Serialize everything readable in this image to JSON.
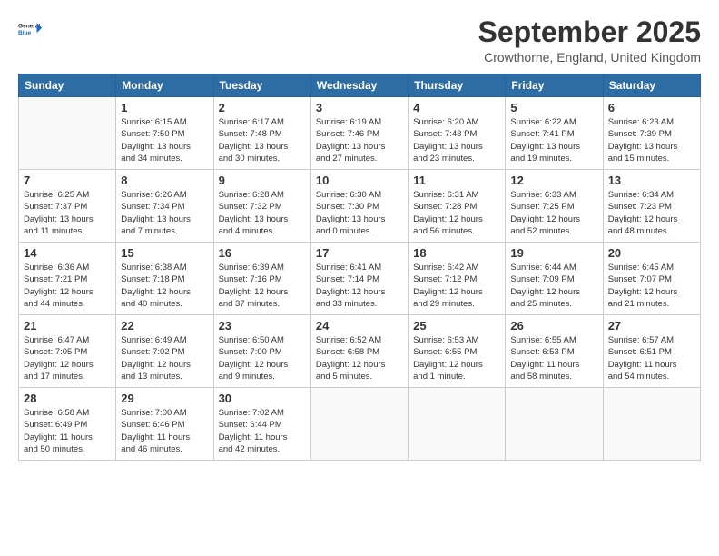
{
  "logo": {
    "general": "General",
    "blue": "Blue"
  },
  "header": {
    "month": "September 2025",
    "location": "Crowthorne, England, United Kingdom"
  },
  "days_of_week": [
    "Sunday",
    "Monday",
    "Tuesday",
    "Wednesday",
    "Thursday",
    "Friday",
    "Saturday"
  ],
  "weeks": [
    [
      {
        "day": "",
        "info": ""
      },
      {
        "day": "1",
        "info": "Sunrise: 6:15 AM\nSunset: 7:50 PM\nDaylight: 13 hours\nand 34 minutes."
      },
      {
        "day": "2",
        "info": "Sunrise: 6:17 AM\nSunset: 7:48 PM\nDaylight: 13 hours\nand 30 minutes."
      },
      {
        "day": "3",
        "info": "Sunrise: 6:19 AM\nSunset: 7:46 PM\nDaylight: 13 hours\nand 27 minutes."
      },
      {
        "day": "4",
        "info": "Sunrise: 6:20 AM\nSunset: 7:43 PM\nDaylight: 13 hours\nand 23 minutes."
      },
      {
        "day": "5",
        "info": "Sunrise: 6:22 AM\nSunset: 7:41 PM\nDaylight: 13 hours\nand 19 minutes."
      },
      {
        "day": "6",
        "info": "Sunrise: 6:23 AM\nSunset: 7:39 PM\nDaylight: 13 hours\nand 15 minutes."
      }
    ],
    [
      {
        "day": "7",
        "info": "Sunrise: 6:25 AM\nSunset: 7:37 PM\nDaylight: 13 hours\nand 11 minutes."
      },
      {
        "day": "8",
        "info": "Sunrise: 6:26 AM\nSunset: 7:34 PM\nDaylight: 13 hours\nand 7 minutes."
      },
      {
        "day": "9",
        "info": "Sunrise: 6:28 AM\nSunset: 7:32 PM\nDaylight: 13 hours\nand 4 minutes."
      },
      {
        "day": "10",
        "info": "Sunrise: 6:30 AM\nSunset: 7:30 PM\nDaylight: 13 hours\nand 0 minutes."
      },
      {
        "day": "11",
        "info": "Sunrise: 6:31 AM\nSunset: 7:28 PM\nDaylight: 12 hours\nand 56 minutes."
      },
      {
        "day": "12",
        "info": "Sunrise: 6:33 AM\nSunset: 7:25 PM\nDaylight: 12 hours\nand 52 minutes."
      },
      {
        "day": "13",
        "info": "Sunrise: 6:34 AM\nSunset: 7:23 PM\nDaylight: 12 hours\nand 48 minutes."
      }
    ],
    [
      {
        "day": "14",
        "info": "Sunrise: 6:36 AM\nSunset: 7:21 PM\nDaylight: 12 hours\nand 44 minutes."
      },
      {
        "day": "15",
        "info": "Sunrise: 6:38 AM\nSunset: 7:18 PM\nDaylight: 12 hours\nand 40 minutes."
      },
      {
        "day": "16",
        "info": "Sunrise: 6:39 AM\nSunset: 7:16 PM\nDaylight: 12 hours\nand 37 minutes."
      },
      {
        "day": "17",
        "info": "Sunrise: 6:41 AM\nSunset: 7:14 PM\nDaylight: 12 hours\nand 33 minutes."
      },
      {
        "day": "18",
        "info": "Sunrise: 6:42 AM\nSunset: 7:12 PM\nDaylight: 12 hours\nand 29 minutes."
      },
      {
        "day": "19",
        "info": "Sunrise: 6:44 AM\nSunset: 7:09 PM\nDaylight: 12 hours\nand 25 minutes."
      },
      {
        "day": "20",
        "info": "Sunrise: 6:45 AM\nSunset: 7:07 PM\nDaylight: 12 hours\nand 21 minutes."
      }
    ],
    [
      {
        "day": "21",
        "info": "Sunrise: 6:47 AM\nSunset: 7:05 PM\nDaylight: 12 hours\nand 17 minutes."
      },
      {
        "day": "22",
        "info": "Sunrise: 6:49 AM\nSunset: 7:02 PM\nDaylight: 12 hours\nand 13 minutes."
      },
      {
        "day": "23",
        "info": "Sunrise: 6:50 AM\nSunset: 7:00 PM\nDaylight: 12 hours\nand 9 minutes."
      },
      {
        "day": "24",
        "info": "Sunrise: 6:52 AM\nSunset: 6:58 PM\nDaylight: 12 hours\nand 5 minutes."
      },
      {
        "day": "25",
        "info": "Sunrise: 6:53 AM\nSunset: 6:55 PM\nDaylight: 12 hours\nand 1 minute."
      },
      {
        "day": "26",
        "info": "Sunrise: 6:55 AM\nSunset: 6:53 PM\nDaylight: 11 hours\nand 58 minutes."
      },
      {
        "day": "27",
        "info": "Sunrise: 6:57 AM\nSunset: 6:51 PM\nDaylight: 11 hours\nand 54 minutes."
      }
    ],
    [
      {
        "day": "28",
        "info": "Sunrise: 6:58 AM\nSunset: 6:49 PM\nDaylight: 11 hours\nand 50 minutes."
      },
      {
        "day": "29",
        "info": "Sunrise: 7:00 AM\nSunset: 6:46 PM\nDaylight: 11 hours\nand 46 minutes."
      },
      {
        "day": "30",
        "info": "Sunrise: 7:02 AM\nSunset: 6:44 PM\nDaylight: 11 hours\nand 42 minutes."
      },
      {
        "day": "",
        "info": ""
      },
      {
        "day": "",
        "info": ""
      },
      {
        "day": "",
        "info": ""
      },
      {
        "day": "",
        "info": ""
      }
    ]
  ]
}
